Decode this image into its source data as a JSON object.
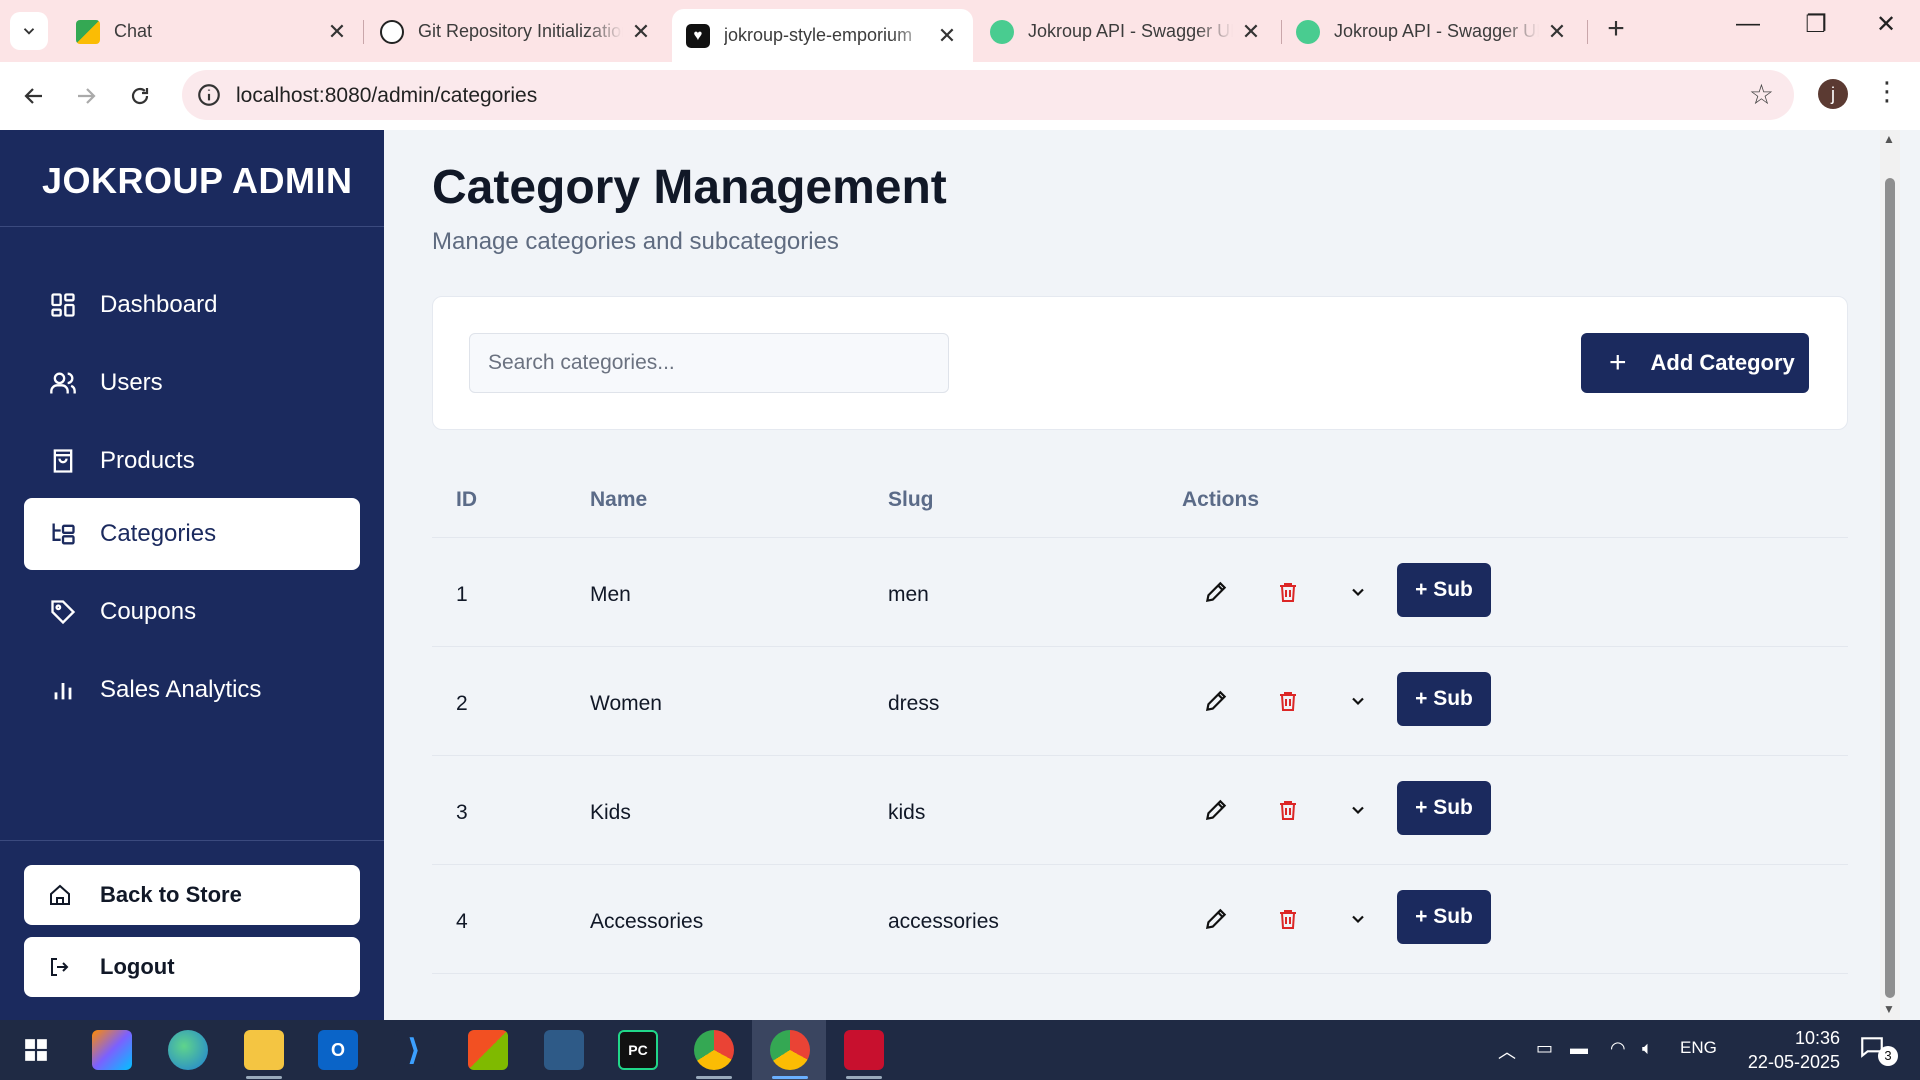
{
  "browser": {
    "tabs": [
      {
        "title": "Chat",
        "active": false
      },
      {
        "title": "Git Repository Initialization",
        "active": false
      },
      {
        "title": "jokroup-style-emporium",
        "active": true
      },
      {
        "title": "Jokroup API - Swagger UI",
        "active": false
      },
      {
        "title": "Jokroup API - Swagger UI",
        "active": false
      }
    ],
    "url": "localhost:8080/admin/categories",
    "profile_initial": "j"
  },
  "sidebar": {
    "brand": "JOKROUP ADMIN",
    "items": [
      {
        "label": "Dashboard",
        "icon": "grid-icon",
        "active": false
      },
      {
        "label": "Users",
        "icon": "users-icon",
        "active": false
      },
      {
        "label": "Products",
        "icon": "shopping-bag-icon",
        "active": false
      },
      {
        "label": "Categories",
        "icon": "folder-tree-icon",
        "active": true
      },
      {
        "label": "Coupons",
        "icon": "tag-icon",
        "active": false
      },
      {
        "label": "Sales Analytics",
        "icon": "bar-chart-icon",
        "active": false
      }
    ],
    "back_to_store": "Back to Store",
    "logout": "Logout"
  },
  "main": {
    "title": "Category Management",
    "subtitle": "Manage categories and subcategories",
    "search_placeholder": "Search categories...",
    "add_button": "Add Category",
    "table": {
      "headers": [
        "ID",
        "Name",
        "Slug",
        "Actions"
      ],
      "sub_button": "+ Sub",
      "rows": [
        {
          "id": "1",
          "name": "Men",
          "slug": "men"
        },
        {
          "id": "2",
          "name": "Women",
          "slug": "dress"
        },
        {
          "id": "3",
          "name": "Kids",
          "slug": "kids"
        },
        {
          "id": "4",
          "name": "Accessories",
          "slug": "accessories"
        }
      ]
    }
  },
  "taskbar": {
    "language": "ENG",
    "time": "10:36",
    "date": "22-05-2025",
    "notification_count": "3"
  },
  "colors": {
    "sidebar_bg": "#1b2a5e",
    "primary_button": "#1b2a5e",
    "delete_icon": "#dc2626",
    "browser_chrome": "#fce4e6"
  }
}
